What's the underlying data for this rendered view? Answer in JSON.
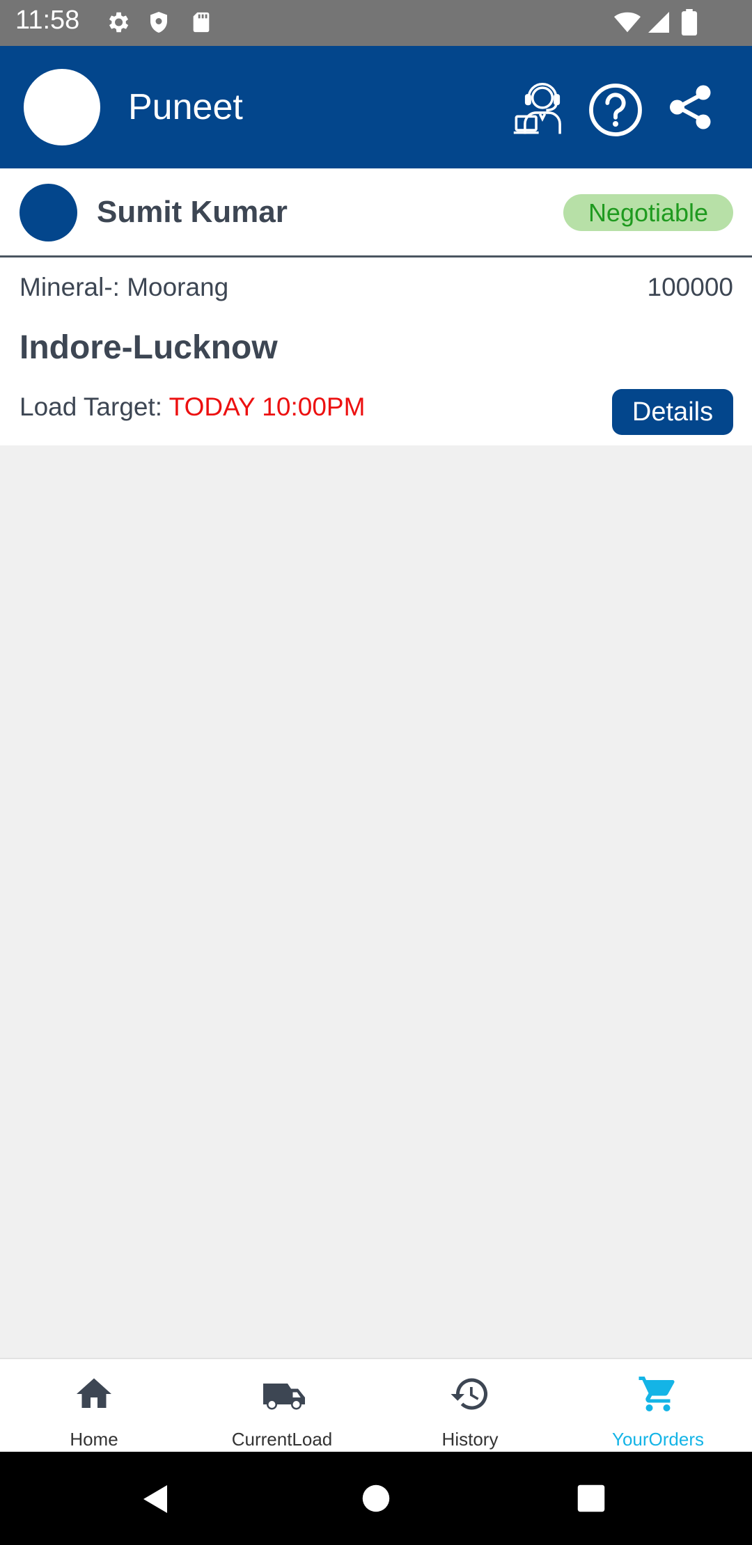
{
  "status_bar": {
    "time": "11:58",
    "icons": [
      "gear-icon",
      "shield-icon",
      "sd-card-icon",
      "wifi-icon",
      "signal-icon",
      "battery-icon"
    ]
  },
  "app_bar": {
    "user_name": "Puneet",
    "icons": [
      "customer-support-icon",
      "help-icon",
      "share-icon"
    ],
    "color": "#03468c"
  },
  "order_card": {
    "seller_name": "Sumit Kumar",
    "badge": "Negotiable",
    "mineral": "Mineral-: Moorang",
    "amount": "100000",
    "route": "Indore-Lucknow",
    "load_target_label": "Load Target: ",
    "load_target_value": "TODAY 10:00PM",
    "details_button": "Details"
  },
  "bottom_nav": {
    "items": [
      {
        "label": "Home",
        "icon": "home-icon"
      },
      {
        "label": "CurrentLoad",
        "icon": "truck-icon"
      },
      {
        "label": "History",
        "icon": "history-icon"
      },
      {
        "label": "YourOrders",
        "icon": "cart-icon",
        "active": true
      }
    ],
    "active_color": "#14b4e6"
  },
  "system_nav": [
    "back-icon",
    "home-circle-icon",
    "recents-icon"
  ]
}
